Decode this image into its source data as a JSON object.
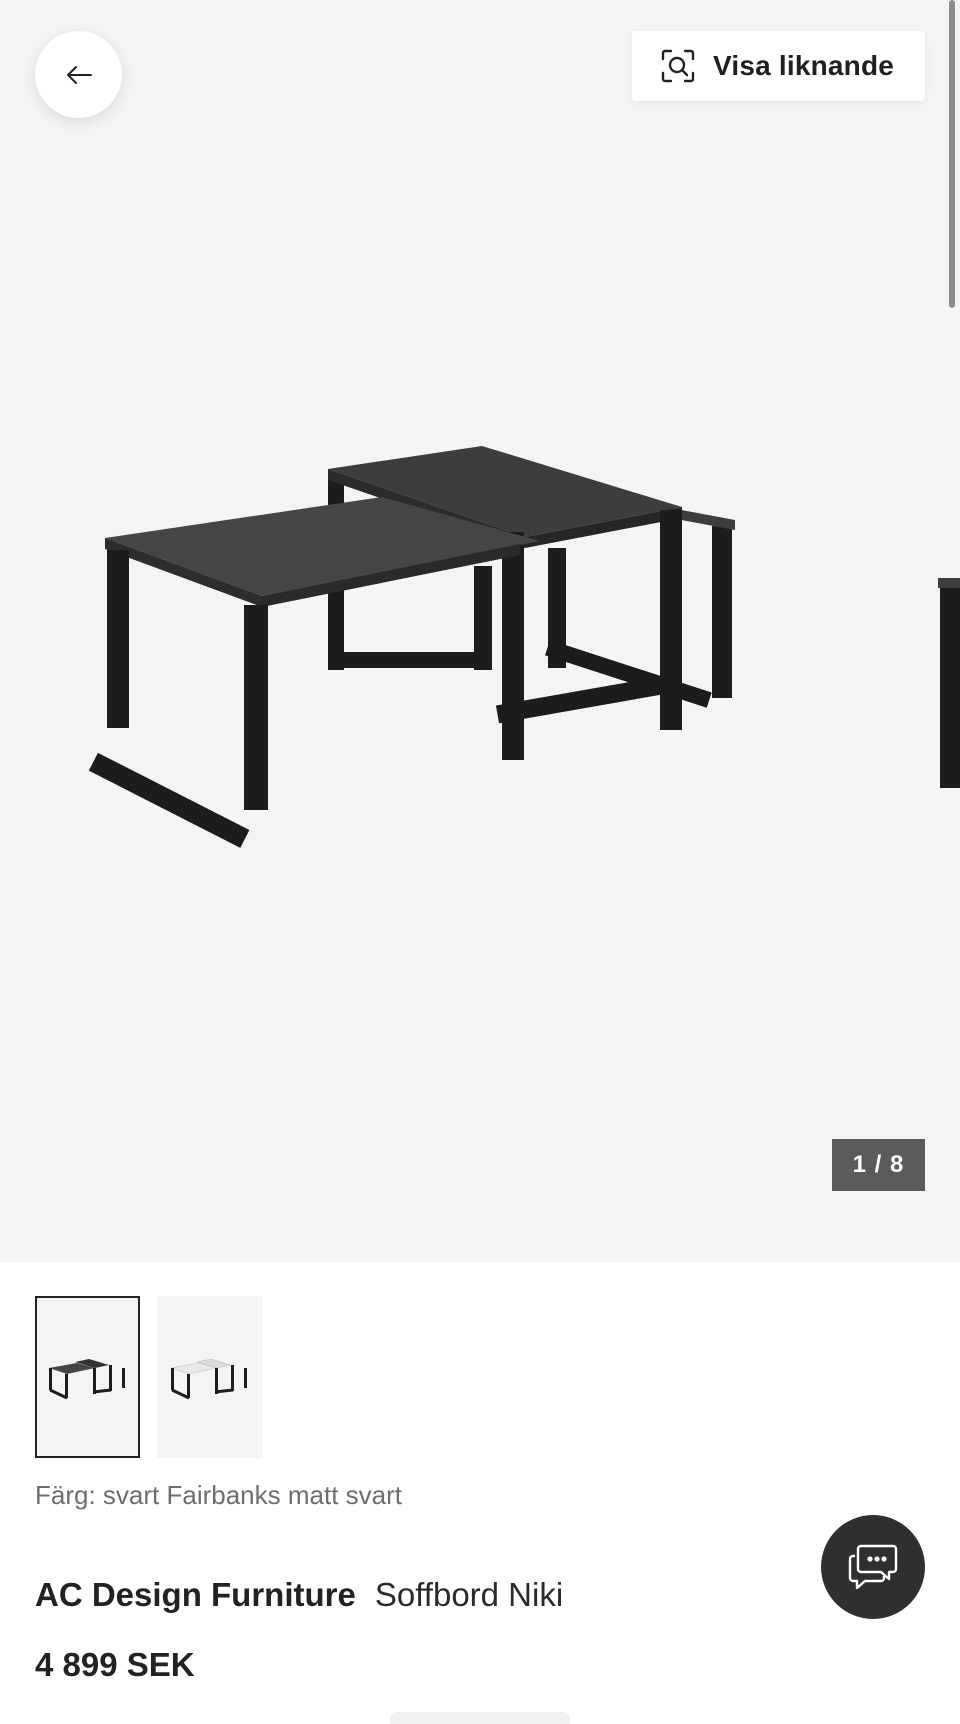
{
  "header": {
    "back_icon": "arrow-left-icon",
    "similar_icon": "visual-search-icon",
    "similar_label": "Visa liknande"
  },
  "gallery": {
    "counter": "1 / 8",
    "current_image": 1,
    "total_images": 8
  },
  "thumbnails": [
    {
      "variant": "black",
      "selected": true
    },
    {
      "variant": "white",
      "selected": false
    }
  ],
  "product": {
    "color_text": "Färg: svart Fairbanks matt svart",
    "brand": "AC Design Furniture",
    "name": "Soffbord Niki",
    "price": "4 899 SEK"
  },
  "chat": {
    "icon": "chat-bubbles-icon"
  },
  "colors": {
    "gallery_bg": "#f4f4f4",
    "counter_bg": "#5b5b5b",
    "chat_bg": "#2f2f2f",
    "table_top_dark": "#3a3a3a",
    "table_frame": "#1c1c1c"
  }
}
